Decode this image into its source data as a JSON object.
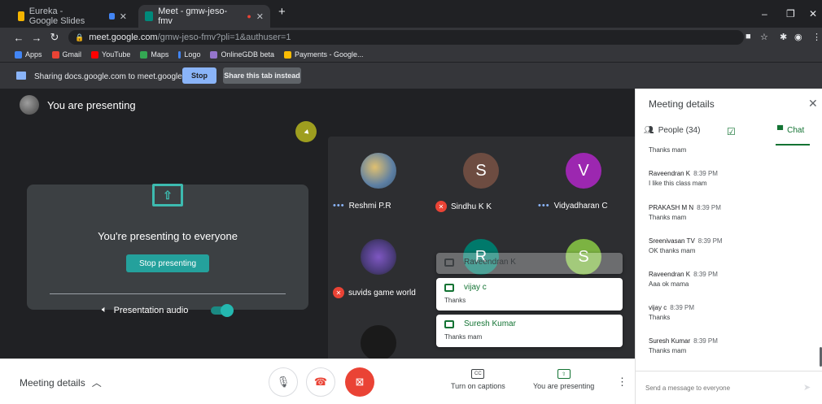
{
  "browser": {
    "tabs": [
      {
        "title": "Eureka - Google Slides",
        "favicon_color": "#f4b400"
      },
      {
        "title": "Meet - gmw-jeso-fmv",
        "favicon_color": "#00897b"
      }
    ],
    "url_host": "meet.google.com",
    "url_path": "/gmw-jeso-fmv?pli=1&authuser=1",
    "bookmarks": [
      {
        "label": "Apps",
        "color": "#4285f4"
      },
      {
        "label": "Gmail",
        "color": "#ea4335"
      },
      {
        "label": "YouTube",
        "color": "#ff0000"
      },
      {
        "label": "Maps",
        "color": "#34a853"
      },
      {
        "label": "Logo",
        "color": "#4285f4"
      },
      {
        "label": "OnlineGDB beta",
        "color": "#ffffff"
      },
      {
        "label": "Payments - Google...",
        "color": "#fbbc04"
      }
    ]
  },
  "sharebar": {
    "text": "Sharing docs.google.com to meet.google.com",
    "stop_label": "Stop",
    "share_tab_label": "Share this tab instead"
  },
  "stage": {
    "presenting_label": "You are presenting",
    "present_title": "You're presenting to everyone",
    "stop_presenting_label": "Stop presenting",
    "audio_label": "Presentation audio"
  },
  "participants": [
    {
      "name": "Reshmi P.R",
      "initial": "",
      "avatar_color": "#5d7fa3",
      "status": "speaking"
    },
    {
      "name": "Sindhu K K",
      "initial": "S",
      "avatar_color": "#6d4c41",
      "status": "muted"
    },
    {
      "name": "Vidyadharan C",
      "initial": "V",
      "avatar_color": "#9c27b0",
      "status": "speaking"
    },
    {
      "name": "suvids game world",
      "initial": "",
      "avatar_color": "#4a3b7a",
      "status": "muted"
    },
    {
      "name": "",
      "initial": "R",
      "avatar_color": "#00796b",
      "status": "none"
    },
    {
      "name": "",
      "initial": "S",
      "avatar_color": "#7cb342",
      "status": "none"
    },
    {
      "name": "",
      "initial": "",
      "avatar_color": "#1a1a1a",
      "status": "none"
    }
  ],
  "toasts": [
    {
      "sender": "Raveendran K",
      "text": ""
    },
    {
      "sender": "vijay c",
      "text": "Thanks"
    },
    {
      "sender": "Suresh Kumar",
      "text": "Thanks mam"
    }
  ],
  "bottombar": {
    "meeting_details_label": "Meeting details",
    "captions_label": "Turn on captions",
    "captions_icon": "CC",
    "presenting_label": "You are presenting"
  },
  "panel": {
    "title": "Meeting details",
    "people_label": "People (34)",
    "chat_label": "Chat",
    "messages": [
      {
        "sender": "",
        "time": "",
        "text": "Thanks mam"
      },
      {
        "sender": "Raveendran K",
        "time": "8:39 PM",
        "text": "I like this class mam"
      },
      {
        "sender": "PRAKASH M N",
        "time": "8:39 PM",
        "text": "Thanks mam"
      },
      {
        "sender": "Sreenivasan TV",
        "time": "8:39 PM",
        "text": "OK thanks mam"
      },
      {
        "sender": "Raveendran K",
        "time": "8:39 PM",
        "text": "Aaa ok mama"
      },
      {
        "sender": "vijay c",
        "time": "8:39 PM",
        "text": "Thanks"
      },
      {
        "sender": "Suresh Kumar",
        "time": "8:39 PM",
        "text": "Thanks mam"
      }
    ],
    "input_placeholder": "Send a message to everyone"
  }
}
